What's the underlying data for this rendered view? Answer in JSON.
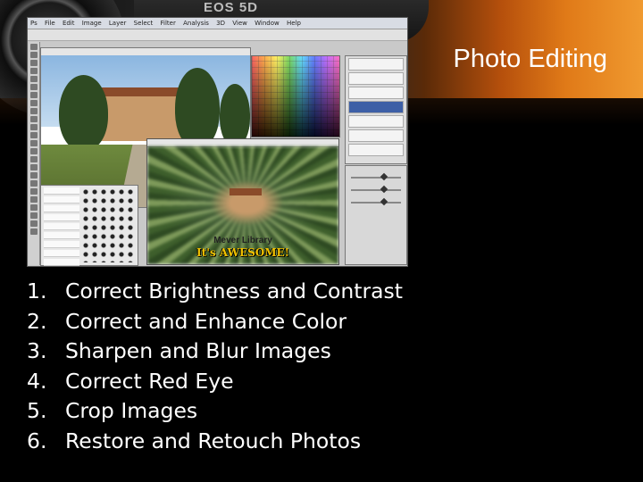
{
  "slide": {
    "title": "Photo Editing",
    "camera_badge": "EOS 5D",
    "items": [
      {
        "number": "1.",
        "text": "Correct Brightness and Contrast"
      },
      {
        "number": "2.",
        "text": "Correct and Enhance Color"
      },
      {
        "number": "3.",
        "text": "Sharpen and Blur Images"
      },
      {
        "number": "4.",
        "text": "Correct Red Eye"
      },
      {
        "number": "5.",
        "text": "Crop Images"
      },
      {
        "number": "6.",
        "text": "Restore and Retouch Photos"
      }
    ]
  },
  "screenshot": {
    "menu": [
      "Ps",
      "File",
      "Edit",
      "Image",
      "Layer",
      "Select",
      "Filter",
      "Analysis",
      "3D",
      "View",
      "Window",
      "Help"
    ],
    "caption_line1": "Mever Library",
    "caption_line2": "It's AWESOME!"
  },
  "colors": {
    "background": "#000000",
    "text": "#ffffff",
    "accent_orange": "#e07a18",
    "caption_yellow": "#f2c200"
  }
}
